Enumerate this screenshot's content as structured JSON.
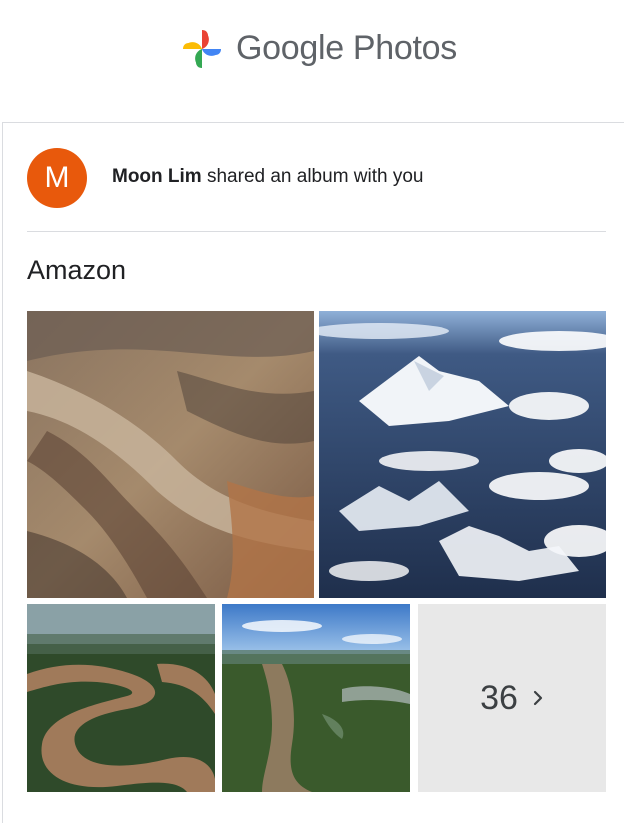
{
  "brand": {
    "google": "Google",
    "photos": "Photos"
  },
  "share": {
    "avatar_letter": "M",
    "owner": "Moon Lim",
    "message": " shared an album with you"
  },
  "album": {
    "title": "Amazon",
    "photos": [
      {
        "subject": "aerial-mountain-desert"
      },
      {
        "subject": "snowy-andes-peaks"
      },
      {
        "subject": "meandering-brown-river"
      },
      {
        "subject": "river-through-jungle"
      }
    ],
    "more_count": "36"
  },
  "icons": [
    "google-photos-logo-icon",
    "chevron-right-icon"
  ],
  "colors": {
    "avatar": "#e8590c",
    "brand_text": "#5f6368",
    "tile_bg": "#e8e8e8"
  }
}
